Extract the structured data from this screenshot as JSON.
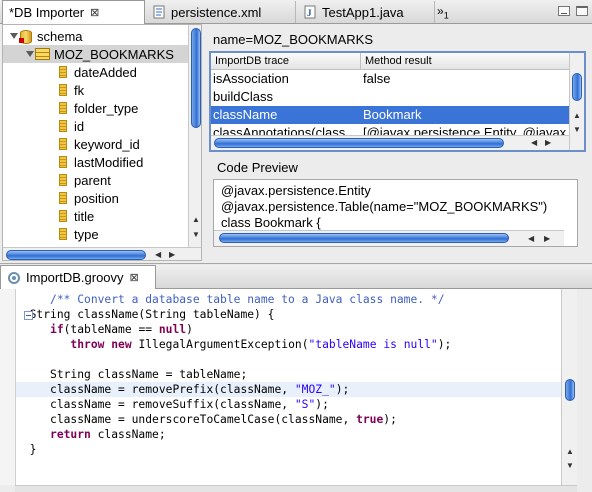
{
  "top_tabs": [
    {
      "label": "*DB Importer",
      "close": "⊠"
    },
    {
      "label": "persistence.xml"
    },
    {
      "label": "TestApp1.java"
    }
  ],
  "overflow": {
    "chevron": "»",
    "count": "1"
  },
  "tree": {
    "root": "schema",
    "table": "MOZ_BOOKMARKS",
    "columns": [
      "dateAdded",
      "fk",
      "folder_type",
      "id",
      "keyword_id",
      "lastModified",
      "parent",
      "position",
      "title",
      "type"
    ]
  },
  "name_label": "name=MOZ_BOOKMARKS",
  "trace": {
    "headers": [
      "ImportDB trace",
      "Method result"
    ],
    "rows": [
      [
        "isAssociation",
        "false"
      ],
      [
        "buildClass",
        ""
      ],
      [
        "className",
        "Bookmark"
      ],
      [
        "classAnnotations(class",
        "[@javax.persistence.Entity, @javax"
      ]
    ],
    "selected_index": 2
  },
  "code_preview": {
    "label": "Code Preview",
    "lines": [
      "@javax.persistence.Entity",
      "@javax.persistence.Table(name=\"MOZ_BOOKMARKS\")",
      "class Bookmark {"
    ]
  },
  "bottom_tab": {
    "label": "ImportDB.groovy",
    "close": "⊠"
  },
  "code": {
    "comment": "/** Convert a database table name to a Java class name. */",
    "sig": "String className(String tableName) {",
    "if_kw": "if",
    "if_rest_a": "(tableName == ",
    "null_kw": "null",
    "if_rest_b": ")",
    "throw_kw": "throw",
    "new_kw": "new",
    "throw_rest_a": " IllegalArgumentException(",
    "throw_str": "\"tableName is null\"",
    "throw_rest_b": ");",
    "assign": "String className = tableName;",
    "prefix_a": "className = removePrefix(className, ",
    "prefix_str": "\"MOZ_\"",
    "prefix_b": ");",
    "suffix_a": "className = removeSuffix(className, ",
    "suffix_str": "\"S\"",
    "suffix_b": ");",
    "camel_a": "className = underscoreToCamelCase(className, ",
    "true_kw": "true",
    "camel_b": ");",
    "return_kw": "return",
    "return_rest": " className;",
    "close_brace": "}"
  },
  "colors": {
    "selection": "#3b74d7",
    "keyword": "#7f0055",
    "comment": "#3f5fbf",
    "string": "#2a00ff",
    "scroll": "#2f6fd6"
  }
}
